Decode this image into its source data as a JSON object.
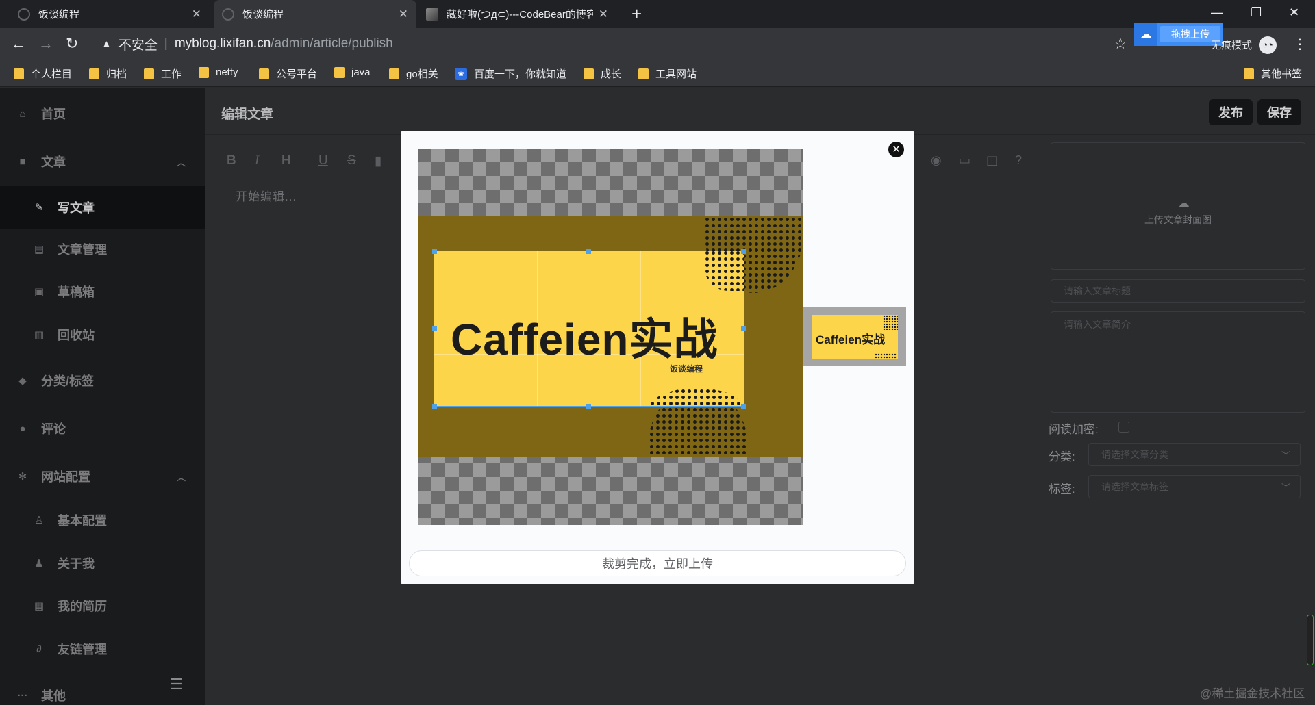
{
  "browser": {
    "tabs": [
      {
        "title": "饭谈编程"
      },
      {
        "title": "饭谈编程"
      },
      {
        "title": "藏好啦(つд⊂)---CodeBear的博客"
      }
    ],
    "address": {
      "insecure_label": "不安全",
      "host": "myblog.lixifan.cn",
      "path": "/admin/article/publish"
    },
    "upload_badge": "拖拽上传",
    "incognito_label": "无痕模式",
    "bookmarks": [
      "个人栏目",
      "归档",
      "工作",
      "netty",
      "公号平台",
      "java",
      "go相关",
      "百度一下，你就知道",
      "成长",
      "工具网站"
    ],
    "other_bookmarks": "其他书签"
  },
  "sidebar": {
    "items": [
      {
        "label": "首页",
        "icon": "home-icon"
      },
      {
        "label": "文章",
        "icon": "article-icon"
      },
      {
        "label": "写文章",
        "icon": "pen-icon"
      },
      {
        "label": "文章管理",
        "icon": "list-icon"
      },
      {
        "label": "草稿箱",
        "icon": "draft-icon"
      },
      {
        "label": "回收站",
        "icon": "trash-icon"
      },
      {
        "label": "分类/标签",
        "icon": "tag-icon"
      },
      {
        "label": "评论",
        "icon": "comment-icon"
      },
      {
        "label": "网站配置",
        "icon": "gear-icon"
      },
      {
        "label": "基本配置",
        "icon": "user-icon"
      },
      {
        "label": "关于我",
        "icon": "person-icon"
      },
      {
        "label": "我的简历",
        "icon": "resume-icon"
      },
      {
        "label": "友链管理",
        "icon": "link-icon"
      },
      {
        "label": "其他",
        "icon": "more-icon"
      }
    ]
  },
  "header": {
    "title": "编辑文章",
    "publish": "发布",
    "save": "保存"
  },
  "editor": {
    "placeholder": "开始编辑..."
  },
  "form": {
    "cover_upload": "上传文章封面图",
    "title_placeholder": "请输入文章标题",
    "intro_placeholder": "请输入文章简介",
    "encrypt_label": "阅读加密:",
    "category_label": "分类:",
    "category_placeholder": "请选择文章分类",
    "tag_label": "标签:",
    "tag_placeholder": "请选择文章标签"
  },
  "modal": {
    "image_title": "Caffeien实战",
    "image_subtitle": "饭谈编程",
    "upload_button": "裁剪完成，立即上传"
  },
  "watermark": "@稀土掘金技术社区"
}
